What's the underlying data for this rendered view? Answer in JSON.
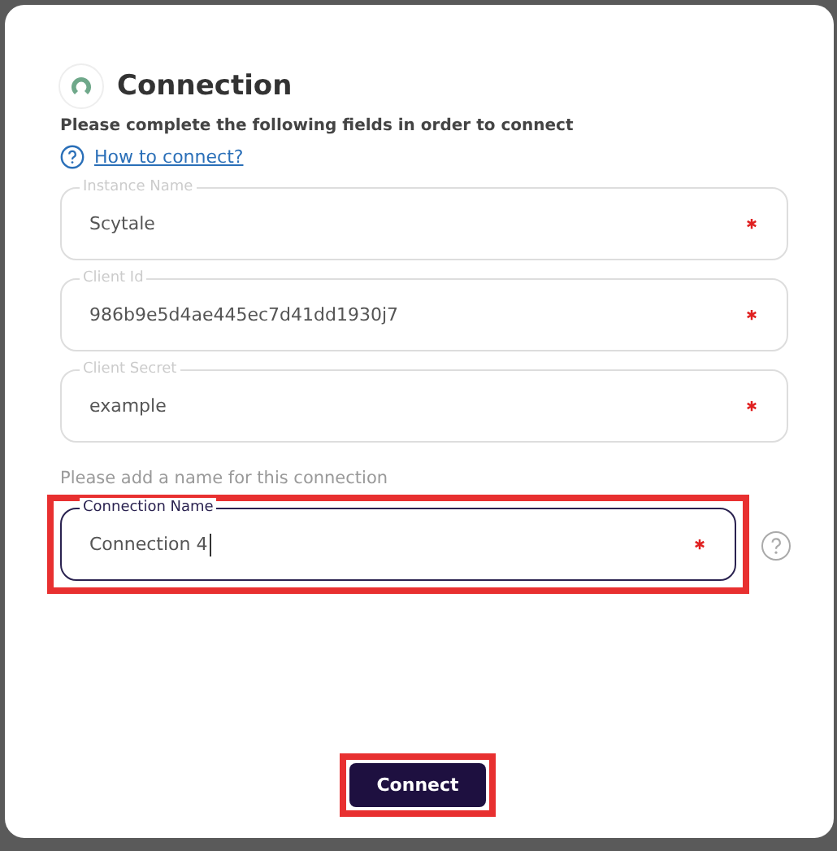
{
  "dialog": {
    "title": "Connection",
    "subtitle": "Please complete the following fields in order to connect",
    "help_link": "How to connect?"
  },
  "fields": [
    {
      "label": "Instance Name",
      "value": "Scytale",
      "required": true,
      "focused": false,
      "highlighted": false
    },
    {
      "label": "Client Id",
      "value": "986b9e5d4ae445ec7d41dd1930j7",
      "required": true,
      "focused": false,
      "highlighted": false
    },
    {
      "label": "Client Secret",
      "value": "example",
      "required": true,
      "focused": false,
      "highlighted": false
    },
    {
      "hint": "Please add a name for this connection",
      "label": "Connection Name",
      "value": "Connection 4",
      "required": true,
      "focused": true,
      "highlighted": true
    }
  ],
  "connect_button": {
    "label": "Connect",
    "highlighted": true
  }
}
